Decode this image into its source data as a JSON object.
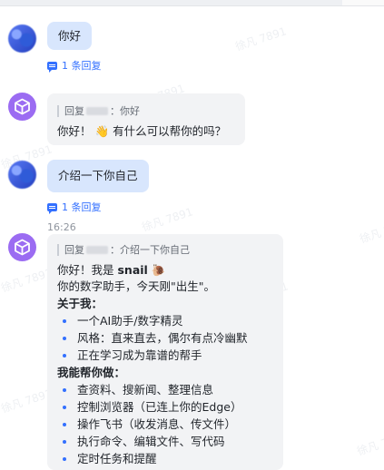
{
  "watermark": "徐凡 7891",
  "messages": [
    {
      "text": "你好",
      "reply_count": "1 条回复"
    },
    {
      "quote_prefix": "回复",
      "quote_tail": "：你好",
      "text": "你好！",
      "emoji": "👋",
      "text2": "有什么可以帮你的吗？"
    },
    {
      "text": "介绍一下你自己",
      "reply_count": "1 条回复"
    },
    {
      "time": "16:26",
      "quote_prefix": "回复",
      "quote_tail": "：介绍一下你自己",
      "greeting": "你好！我是 ",
      "name": "snail",
      "emoji": "🐌",
      "line2": "你的数字助手，今天刚\"出生\"。",
      "about_title": "关于我：",
      "about": [
        "一个AI助手/数字精灵",
        "风格：直来直去，偶尔有点冷幽默",
        "正在学习成为靠谱的帮手"
      ],
      "can_title": "我能帮你做：",
      "can": [
        "查资料、搜新闻、整理信息",
        "控制浏览器（已连上你的Edge）",
        "操作飞书（收发消息、传文件）",
        "执行命令、编辑文件、写代码",
        "定时任务和提醒"
      ]
    }
  ]
}
